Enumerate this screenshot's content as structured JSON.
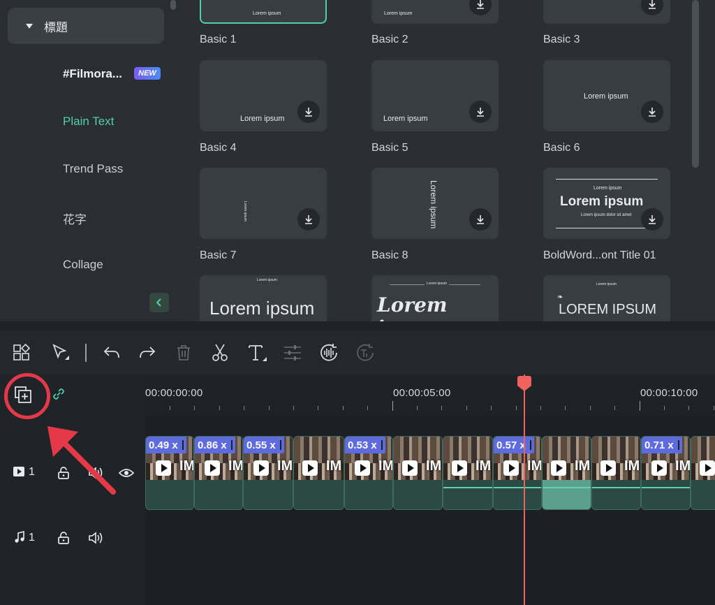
{
  "sidebar": {
    "category": "標題",
    "items": [
      {
        "label": "#Filmora..."
      },
      {
        "label": "Plain Text"
      },
      {
        "label": "Trend Pass"
      },
      {
        "label": "花字"
      },
      {
        "label": "Collage"
      }
    ],
    "new_badge": "NEW"
  },
  "library": {
    "cards": [
      {
        "label": "Basic 1",
        "preview": "Lorem ipsum"
      },
      {
        "label": "Basic 2",
        "preview": "Lorem ipsum"
      },
      {
        "label": "Basic 3",
        "preview": ""
      },
      {
        "label": "Basic 4",
        "preview": "Lorem ipsum"
      },
      {
        "label": "Basic 5",
        "preview": "Lorem ipsum"
      },
      {
        "label": "Basic 6",
        "preview": "Lorem ipsum"
      },
      {
        "label": "Basic 7",
        "preview": "Lorem ipsum"
      },
      {
        "label": "Basic 8",
        "preview": "Lorem ipsum"
      },
      {
        "label": "BoldWord...ont Title 01",
        "preview": "Lorem ipsum",
        "preview_sub": "Lorem ipsum dolor sit amet",
        "preview_top": "Lorem ipsum"
      },
      {
        "label": "",
        "preview": "Lorem ipsum",
        "preview_top": "Lorem ipsum"
      },
      {
        "label": "",
        "preview": "Lorem ipsum",
        "preview_top": "Lorem ipsum"
      },
      {
        "label": "",
        "preview": "LOREM IPSUM",
        "preview_top": "Lorem ipsum"
      }
    ]
  },
  "timeline": {
    "timecodes": [
      "00:00:00:00",
      "00:00:05:00",
      "00:00:10:00"
    ],
    "video_track": {
      "number": "1"
    },
    "audio_track": {
      "number": "1"
    },
    "clips": [
      {
        "speed": "0.49 x",
        "im": "IM"
      },
      {
        "speed": "0.86 x",
        "im": "IM"
      },
      {
        "speed": "0.55 x",
        "im": "IM"
      },
      {
        "speed": "",
        "im": "IM"
      },
      {
        "speed": "0.53 x",
        "im": "IM"
      },
      {
        "speed": "",
        "im": "IM"
      },
      {
        "speed": "",
        "im": "IM"
      },
      {
        "speed": "0.57 x",
        "im": "IM"
      },
      {
        "speed": "",
        "im": "IM"
      },
      {
        "speed": "",
        "im": "IM"
      },
      {
        "speed": "0.71 x",
        "im": "IM"
      },
      {
        "speed": "",
        "im": "IM"
      }
    ]
  },
  "colors": {
    "accent": "#4fd1a9",
    "playhead": "#f0625e",
    "annotation": "#e5394a",
    "speed_badge": "#5d6bde"
  }
}
